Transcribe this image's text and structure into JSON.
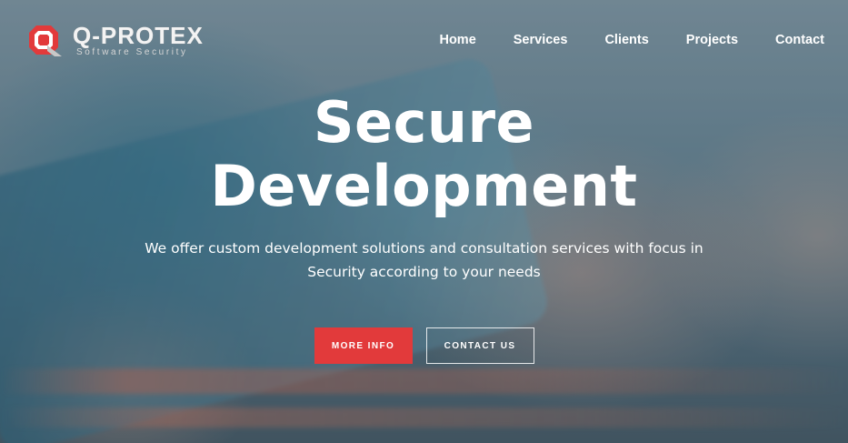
{
  "brand": {
    "name": "Q-PROTEX",
    "tagline": "Software Security",
    "accent_color": "#e23a3b"
  },
  "nav": {
    "items": [
      {
        "label": "Home"
      },
      {
        "label": "Services"
      },
      {
        "label": "Clients"
      },
      {
        "label": "Projects"
      },
      {
        "label": "Contact"
      }
    ]
  },
  "hero": {
    "title_line1": "Secure",
    "title_line2": "Development",
    "subtitle": "We offer custom development solutions and consultation services with focus in Security according to your needs",
    "primary_button": "MORE INFO",
    "secondary_button": "CONTACT US"
  }
}
